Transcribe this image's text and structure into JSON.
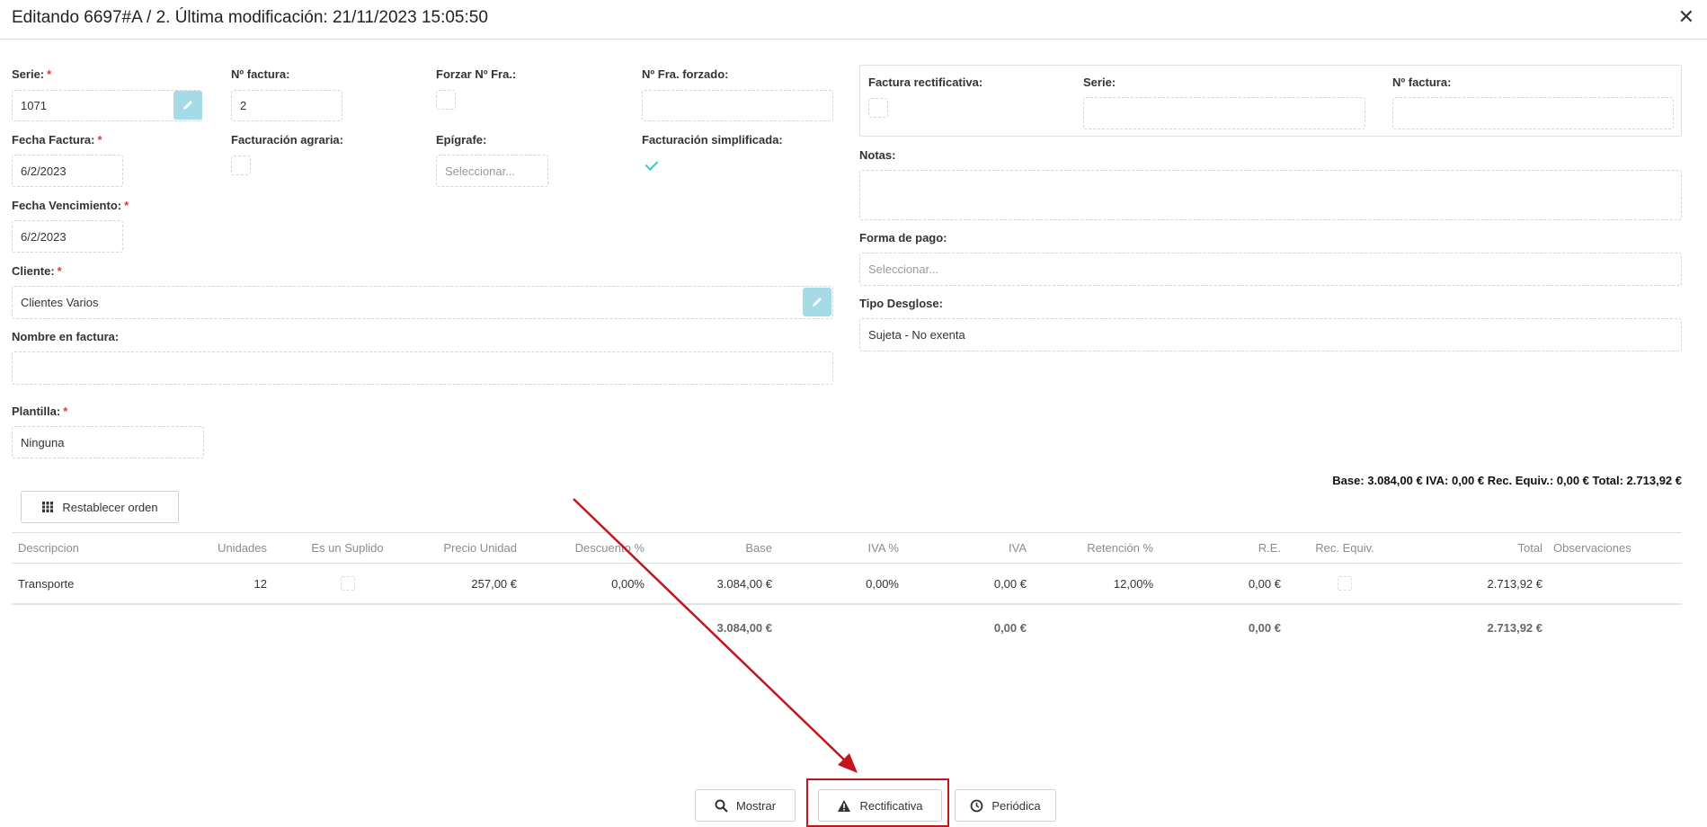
{
  "header": {
    "title": "Editando 6697#A / 2. Última modificación: 21/11/2023 15:05:50",
    "close": "✕"
  },
  "form": {
    "serie": {
      "label": "Serie:",
      "value": "1071"
    },
    "numero": {
      "label": "Nº factura:",
      "value": "2"
    },
    "forzar": {
      "label": "Forzar Nº Fra.:",
      "checked": false
    },
    "forzado": {
      "label": "Nº Fra. forzado:",
      "value": ""
    },
    "fecha": {
      "label": "Fecha Factura:",
      "value": "6/2/2023"
    },
    "agraria": {
      "label": "Facturación agraria:",
      "checked": false
    },
    "epigrafe": {
      "label": "Epígrafe:",
      "placeholder": "Seleccionar..."
    },
    "simplificada": {
      "label": "Facturación simplificada:",
      "checked": true
    },
    "vencimiento": {
      "label": "Fecha Vencimiento:",
      "value": "6/2/2023"
    },
    "cliente": {
      "label": "Cliente:",
      "value": "Clientes Varios"
    },
    "nombre": {
      "label": "Nombre en factura:",
      "value": ""
    },
    "plantilla": {
      "label": "Plantilla:",
      "value": "Ninguna"
    },
    "required_mark": "*"
  },
  "rectificativa_panel": {
    "check_label": "Factura rectificativa:",
    "checked": false,
    "serie_label": "Serie:",
    "serie_value": "",
    "numero_label": "Nº factura:",
    "numero_value": ""
  },
  "notas": {
    "label": "Notas:",
    "value": ""
  },
  "forma_pago": {
    "label": "Forma de pago:",
    "placeholder": "Seleccionar..."
  },
  "tipo_desglose": {
    "label": "Tipo Desglose:",
    "value": "Sujeta - No exenta"
  },
  "totals_line": "Base: 3.084,00 € IVA: 0,00 € Rec. Equiv.: 0,00 € Total: 2.713,92 €",
  "restablecer_label": "Restablecer orden",
  "grid": {
    "headers": [
      "Descripcion",
      "Unidades",
      "Es un Suplido",
      "Precio Unidad",
      "Descuento %",
      "Base",
      "IVA %",
      "IVA",
      "Retención %",
      "R.E.",
      "Rec. Equiv.",
      "Total",
      "Observaciones"
    ],
    "row": {
      "descripcion": "Transporte",
      "unidades": "12",
      "suplido": false,
      "precio": "257,00 €",
      "descuento": "0,00%",
      "base": "3.084,00 €",
      "iva_pct": "0,00%",
      "iva": "0,00 €",
      "retencion": "12,00%",
      "re": "0,00 €",
      "rec_equiv": false,
      "total": "2.713,92 €",
      "observaciones": ""
    },
    "footer": {
      "base": "3.084,00 €",
      "iva": "0,00 €",
      "re": "0,00 €",
      "total": "2.713,92 €"
    }
  },
  "buttons": {
    "mostrar": "Mostrar",
    "rectificativa": "Rectificativa",
    "periodica": "Periódica"
  },
  "colors": {
    "highlight": "#c0161c",
    "accent": "#3cc6c4",
    "edit_button": "#a4dbe6",
    "required": "#e53935"
  },
  "icons": {
    "edit": "pencil-icon",
    "close": "close-icon",
    "reorder": "columns-icon",
    "mostrar": "search-icon",
    "rectificativa": "warning-icon",
    "periodica": "clock-icon"
  }
}
